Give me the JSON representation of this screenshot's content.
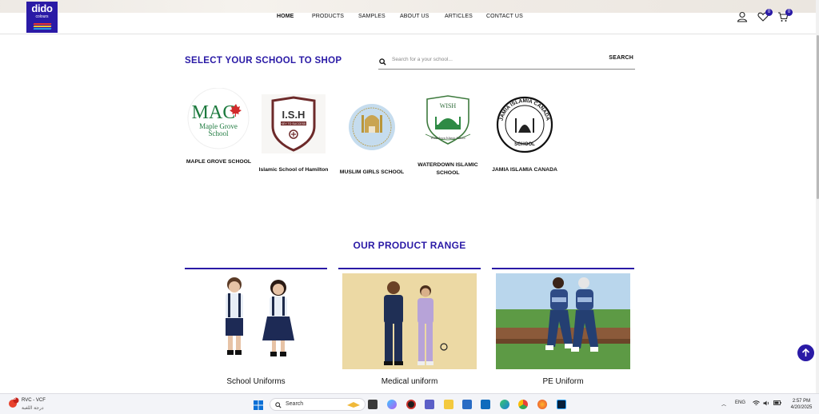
{
  "header": {
    "logo": {
      "line1": "dido",
      "line2": "colours"
    },
    "nav": [
      {
        "label": "HOME",
        "active": true
      },
      {
        "label": "PRODUCTS",
        "active": false
      },
      {
        "label": "SAMPLES",
        "active": false
      },
      {
        "label": "ABOUT US",
        "active": false
      },
      {
        "label": "ARTICLES",
        "active": false
      },
      {
        "label": "CONTACT US",
        "active": false
      }
    ],
    "wishlist_count": "0",
    "cart_count": "0"
  },
  "schools_section": {
    "title": "SELECT YOUR SCHOOL TO SHOP",
    "search_placeholder": "Search for a your school...",
    "search_button": "SEARCH",
    "schools": [
      {
        "name": "MAPLE GROVE SCHOOL",
        "logo_text": "MAC",
        "logo_sub": "Maple Grove School"
      },
      {
        "name": "Islamic School of Hamilton",
        "logo_text": "I.S.H",
        "logo_sub": "KEY TO SUCCESS"
      },
      {
        "name": "MUSLIM GIRLS SCHOOL"
      },
      {
        "name": "WATERDOWN ISLAMIC SCHOOL",
        "logo_text": "WISH",
        "logo_sub": "Waterdown Islamic School"
      },
      {
        "name": "JAMIA ISLAMIA CANADA",
        "logo_text": "JAMIA ISLAMIA CANADA",
        "logo_sub": "SCHOOL"
      }
    ]
  },
  "product_section": {
    "title": "OUR PRODUCT RANGE",
    "products": [
      {
        "name": "School Uniforms"
      },
      {
        "name": "Medical uniform"
      },
      {
        "name": "PE Uniform"
      }
    ]
  },
  "taskbar": {
    "notification_title": "RVC - VCF",
    "notification_sub": "درجة اللغبة",
    "notification_count": "3",
    "search_label": "Search",
    "language": "ENG",
    "time": "2:57 PM",
    "date": "4/20/2025"
  },
  "colors": {
    "brand": "#2a1aa6"
  }
}
